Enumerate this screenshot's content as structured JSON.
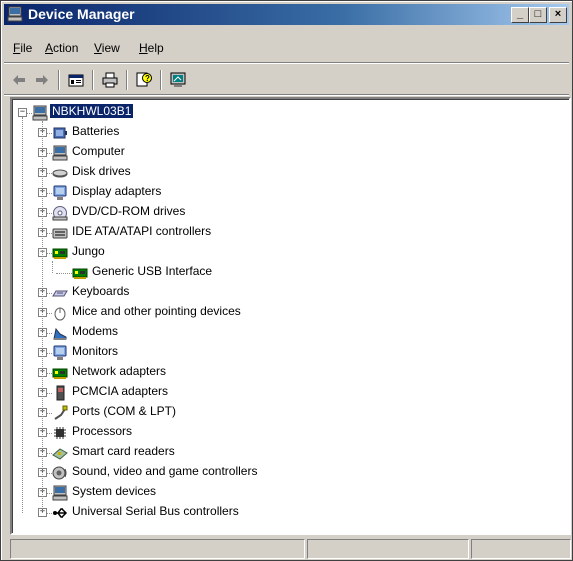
{
  "window": {
    "title": "Device Manager",
    "icon": "computer-icon",
    "controls": {
      "minimize": "_",
      "maximize": "□",
      "close": "×"
    }
  },
  "menu": [
    {
      "key": "file",
      "label": "File"
    },
    {
      "key": "action",
      "label": "Action"
    },
    {
      "key": "view",
      "label": "View"
    },
    {
      "key": "help",
      "label": "Help"
    }
  ],
  "toolbar": [
    {
      "key": "back",
      "icon": "back-arrow-icon"
    },
    {
      "key": "forward",
      "icon": "forward-arrow-icon"
    },
    {
      "key": "properties",
      "icon": "properties-icon"
    },
    {
      "key": "print",
      "icon": "print-icon"
    },
    {
      "key": "help",
      "icon": "help-icon"
    },
    {
      "key": "scan",
      "icon": "scan-hardware-icon"
    }
  ],
  "tree": {
    "root": {
      "label": "NBKHWL03B1",
      "icon": "computer-icon",
      "expanded": true,
      "selected": true
    },
    "categories": [
      {
        "label": "Batteries",
        "icon": "battery-icon",
        "expanded": false
      },
      {
        "label": "Computer",
        "icon": "computer-icon",
        "expanded": false
      },
      {
        "label": "Disk drives",
        "icon": "disk-icon",
        "expanded": false
      },
      {
        "label": "Display adapters",
        "icon": "display-icon",
        "expanded": false
      },
      {
        "label": "DVD/CD-ROM drives",
        "icon": "dvd-icon",
        "expanded": false
      },
      {
        "label": "IDE ATA/ATAPI controllers",
        "icon": "ide-icon",
        "expanded": false
      },
      {
        "label": "Jungo",
        "icon": "board-icon",
        "expanded": true,
        "children": [
          {
            "label": "Generic USB Interface",
            "icon": "board-icon"
          }
        ]
      },
      {
        "label": "Keyboards",
        "icon": "keyboard-icon",
        "expanded": false
      },
      {
        "label": "Mice and other pointing devices",
        "icon": "mouse-icon",
        "expanded": false
      },
      {
        "label": "Modems",
        "icon": "modem-icon",
        "expanded": false
      },
      {
        "label": "Monitors",
        "icon": "monitor-icon",
        "expanded": false
      },
      {
        "label": "Network adapters",
        "icon": "board-icon",
        "expanded": false
      },
      {
        "label": "PCMCIA adapters",
        "icon": "pcmcia-icon",
        "expanded": false
      },
      {
        "label": "Ports (COM & LPT)",
        "icon": "port-icon",
        "expanded": false
      },
      {
        "label": "Processors",
        "icon": "processor-icon",
        "expanded": false
      },
      {
        "label": "Smart card readers",
        "icon": "smartcard-icon",
        "expanded": false
      },
      {
        "label": "Sound, video and game controllers",
        "icon": "sound-icon",
        "expanded": false
      },
      {
        "label": "System devices",
        "icon": "computer-icon",
        "expanded": false
      },
      {
        "label": "Universal Serial Bus controllers",
        "icon": "usb-icon",
        "expanded": false
      }
    ]
  },
  "colors": {
    "selection": "#0a246a",
    "titlebar_start": "#0a246a",
    "titlebar_end": "#a6caf0",
    "face": "#d4d0c8"
  }
}
